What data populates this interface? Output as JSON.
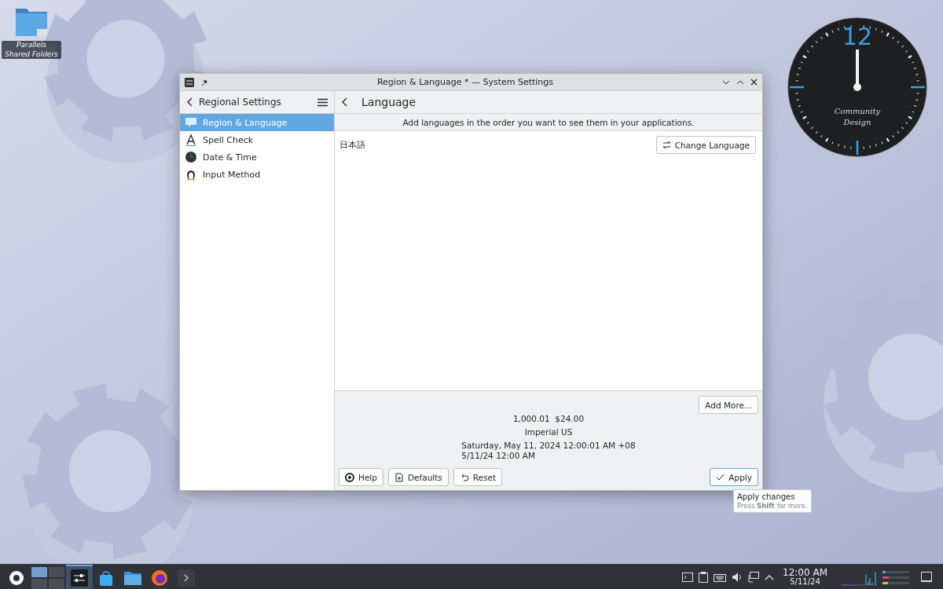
{
  "desktop_icons": [
    {
      "label": "Parallels Shared Folders"
    }
  ],
  "clock_widget": {
    "hour_label": "12",
    "caption": [
      "Community",
      "Design"
    ]
  },
  "window": {
    "title": "Region & Language * — System Settings",
    "sidebar": {
      "title": "Regional Settings",
      "items": [
        {
          "label": "Region & Language",
          "selected": true
        },
        {
          "label": "Spell Check",
          "selected": false
        },
        {
          "label": "Date & Time",
          "selected": false
        },
        {
          "label": "Input Method",
          "selected": false
        }
      ]
    },
    "page": {
      "title": "Language",
      "info": "Add languages in the order you want to see them in your applications.",
      "languages": [
        "日本語"
      ],
      "change_button": "Change Language",
      "add_button": "Add More...",
      "examples": [
        "1,000.01  $24.00",
        "Imperial US"
      ],
      "date_examples": [
        "Saturday, May 11, 2024 12:00:01 AM +08",
        "5/11/24 12:00 AM"
      ]
    },
    "buttons": [
      {
        "label": "Help",
        "kind": "help"
      },
      {
        "label": "Defaults",
        "kind": "defaults"
      },
      {
        "label": "Reset",
        "kind": "reset"
      }
    ],
    "apply_button": {
      "label": "Apply",
      "focused": true
    }
  },
  "tooltip": {
    "title": "Apply changes",
    "hint": "Press **Shift** for more."
  },
  "taskbar": {
    "apps": [
      {
        "kind": "launcher",
        "active": false
      },
      {
        "kind": "pager",
        "active": false
      },
      {
        "kind": "settings",
        "active": true
      },
      {
        "kind": "store",
        "active": false
      },
      {
        "kind": "files",
        "active": false
      },
      {
        "kind": "browser",
        "active": false
      },
      {
        "kind": "terminal",
        "active": false
      }
    ],
    "tray": [
      {
        "kind": "console"
      },
      {
        "kind": "clipboard"
      },
      {
        "kind": "keyboard"
      },
      {
        "kind": "volume"
      },
      {
        "kind": "network"
      },
      {
        "kind": "expand"
      }
    ],
    "time": "12:00 AM",
    "date": "5/11/24"
  }
}
